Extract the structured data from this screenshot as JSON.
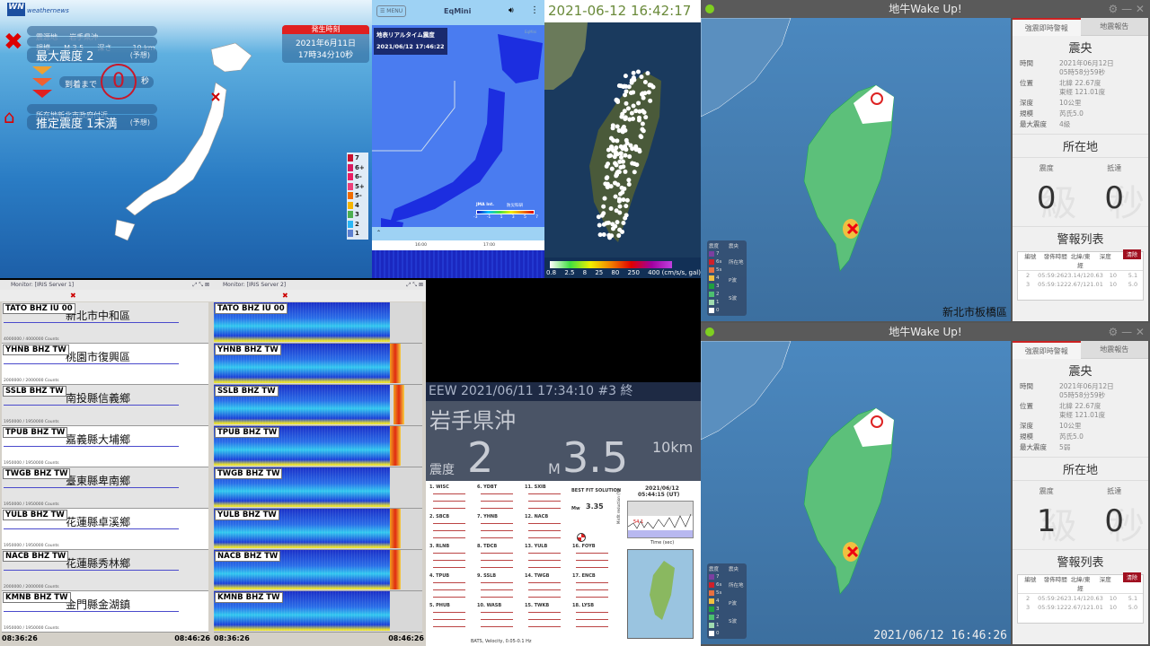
{
  "weathernews": {
    "logo": "weathernews",
    "epicenter_label": "震源地",
    "epicenter": "岩手県沖",
    "magnitude_label": "規模",
    "magnitude": "M 3.5",
    "depth_label": "深さ",
    "depth": "10 km",
    "max_intensity": "最大震度 2",
    "forecast": "(予想)",
    "arrival_label": "到着まで",
    "countdown": "0",
    "seconds": "秒",
    "location_label": "所在地新北市政府付近",
    "est_intensity": "推定震度 1未満",
    "forecast2": "(予想)",
    "occurrence_header": "発生時刻",
    "occurrence_date": "2021年6月11日",
    "occurrence_time": "17時34分10秒",
    "scale": [
      "7",
      "6+",
      "6-",
      "5+",
      "5-",
      "4",
      "3",
      "2",
      "1"
    ],
    "scale_colors": [
      "#c8102e",
      "#d81b60",
      "#e91e63",
      "#ec407a",
      "#ef6c00",
      "#f5b400",
      "#4caf50",
      "#29b6f6",
      "#5c7fd0"
    ]
  },
  "eqmini": {
    "menu": "MENU",
    "title": "EqMini",
    "watermark": "EqMini",
    "overlay_title": "地表リアルタイム震度",
    "overlay_time": "2021/06/12 17:46:22",
    "legend_label": "JMA Int.",
    "provider": "防災科研",
    "legend_ticks": [
      "-3",
      "-1",
      "1",
      "3",
      "5",
      "7"
    ],
    "timeline": [
      "16:00",
      "17:00"
    ]
  },
  "taiwan_stations": {
    "timestamp": "2021-06-12 16:42:17",
    "scale_ticks": [
      "0.8",
      "2.5",
      "8",
      "25",
      "80",
      "250",
      "400 (cm/s/s, gal)"
    ]
  },
  "wakeup": [
    {
      "title": "地牛Wake Up!",
      "tabs": [
        "強震即時警報",
        "地震報告"
      ],
      "epicenter_heading": "震央",
      "fields": [
        {
          "k": "時間",
          "v": "2021年06月12日\n05時58分59秒"
        },
        {
          "k": "位置",
          "v": "北緯 22.67度\n東經 121.01度"
        },
        {
          "k": "深度",
          "v": "10公里"
        },
        {
          "k": "規模",
          "v": "芮氏5.0"
        },
        {
          "k": "最大震度",
          "v": "4級"
        }
      ],
      "location_heading": "所在地",
      "intensity_label": "震度",
      "intensity": "0",
      "arrival_label": "抵達",
      "arrival": "0",
      "wm_intensity": "級",
      "wm_arrival": "秒",
      "alert_heading": "警報列表",
      "clear_button": "清除",
      "table_headers": [
        "編號",
        "發佈時間",
        "北緯/東經",
        "深度",
        "規模"
      ],
      "table_rows": [
        [
          "2",
          "05:59:26",
          "23.14/120.63",
          "10",
          "5.1"
        ],
        [
          "3",
          "05:59:12",
          "22.67/121.01",
          "10",
          "5.0"
        ]
      ],
      "map_caption": "新北市板橋區"
    },
    {
      "title": "地牛Wake Up!",
      "tabs": [
        "強震即時警報",
        "地震報告"
      ],
      "epicenter_heading": "震央",
      "fields": [
        {
          "k": "時間",
          "v": "2021年06月12日\n05時58分59秒"
        },
        {
          "k": "位置",
          "v": "北緯 22.67度\n東經 121.01度"
        },
        {
          "k": "深度",
          "v": "10公里"
        },
        {
          "k": "規模",
          "v": "芮氏5.0"
        },
        {
          "k": "最大震度",
          "v": "5弱"
        }
      ],
      "location_heading": "所在地",
      "intensity_label": "震度",
      "intensity": "1",
      "arrival_label": "抵達",
      "arrival": "0",
      "wm_intensity": "級",
      "wm_arrival": "秒",
      "alert_heading": "警報列表",
      "clear_button": "清除",
      "table_headers": [
        "編號",
        "發佈時間",
        "北緯/東經",
        "深度",
        "規模"
      ],
      "table_rows": [
        [
          "2",
          "05:59:26",
          "23.14/120.63",
          "10",
          "5.1"
        ],
        [
          "3",
          "05:59:12",
          "22.67/121.01",
          "10",
          "5.0"
        ]
      ],
      "map_caption": "2021/06/12  16:46:26"
    }
  ],
  "map_legend": {
    "intensity": "震度",
    "epicenter": "震央",
    "levels": [
      "7",
      "6s",
      "5s",
      "4",
      "3",
      "2",
      "1",
      "0"
    ],
    "level_colors": [
      "#7b3fa0",
      "#d0202a",
      "#e87040",
      "#f0c040",
      "#1fa040",
      "#4cc070",
      "#a0dcb0",
      "#ffffff"
    ],
    "markers": [
      "所在地",
      "P波",
      "S波"
    ]
  },
  "monitors": {
    "titles": [
      "Monitor: [IRIS Server 1]",
      "Monitor: [IRIS Server 2]"
    ],
    "stations": [
      {
        "code": "TATO BHZ IU 00",
        "place": "新北市中和區",
        "counts": "4000000 / 4000000 Counts"
      },
      {
        "code": "YHNB BHZ TW",
        "place": "桃園市復興區",
        "counts": "2000000 / 2000000 Counts"
      },
      {
        "code": "SSLB BHZ TW",
        "place": "南投縣信義鄉",
        "counts": "1950000 / 1950000 Counts"
      },
      {
        "code": "TPUB BHZ TW",
        "place": "嘉義縣大埔鄉",
        "counts": "1950000 / 1950000 Counts"
      },
      {
        "code": "TWGB BHZ TW",
        "place": "臺東縣卑南鄉",
        "counts": "1950000 / 1950000 Counts"
      },
      {
        "code": "YULB BHZ TW",
        "place": "花蓮縣卓溪鄉",
        "counts": "1950000 / 1950000 Counts"
      },
      {
        "code": "NACB BHZ TW",
        "place": "花蓮縣秀林鄉",
        "counts": "2000000 / 2000000 Counts"
      },
      {
        "code": "KMNB BHZ TW",
        "place": "金門縣金湖鎮",
        "counts": "1950000 / 1950000 Counts"
      }
    ],
    "start_time": "08:36:26",
    "end_time": "08:46:26"
  },
  "eew": {
    "header": "EEW 2021/06/11 17:34:10 #3 終",
    "region": "岩手県沖",
    "intensity_label": "震度",
    "intensity": "2",
    "mag_prefix": "M",
    "magnitude": "3.5",
    "depth": "10km"
  },
  "bats": {
    "title": "BEST FIT SOLUTION",
    "mw_label": "Mw",
    "mw": "3.35",
    "date": "2021/06/12",
    "time": "05:44:15 (UT)",
    "chart_value": "54.1",
    "xlabel": "Time (sec)",
    "ylabel": "Misfit reduction (%)",
    "stations": [
      "1. WISC",
      "2. SBCB",
      "3. RLNB",
      "4. TPUB",
      "5. PHUB",
      "6. YDBT",
      "7. YHNB",
      "8. TDCB",
      "9. SSLB",
      "10. WASB",
      "11. SXIB",
      "12. NACB",
      "13. YULB",
      "14. TWGB",
      "15. TWKB",
      "16. FOYB",
      "17. ENCB",
      "18. LYSB"
    ],
    "footer": "BATS, Velocity, 0.05-0.1 Hz"
  }
}
